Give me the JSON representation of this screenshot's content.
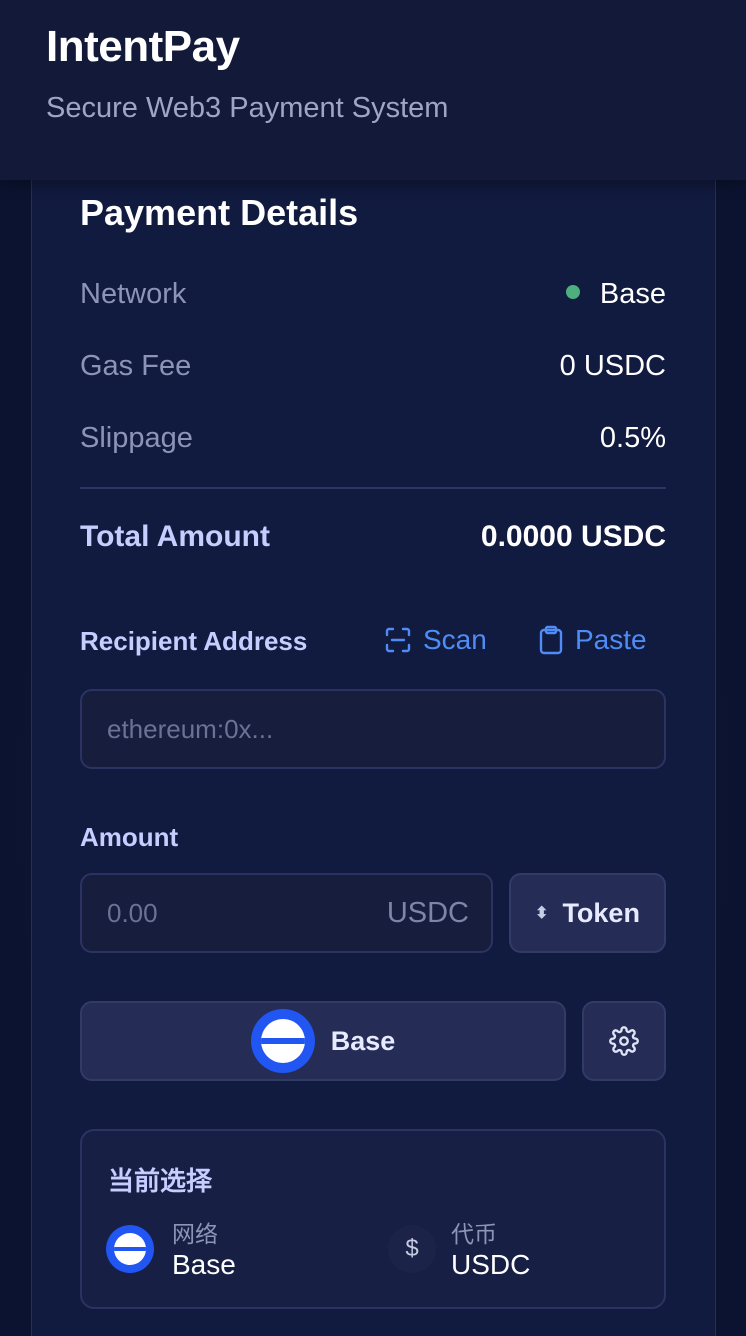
{
  "header": {
    "title": "IntentPay",
    "subtitle": "Secure Web3 Payment System"
  },
  "details": {
    "title": "Payment Details",
    "network_label": "Network",
    "network_value": "Base",
    "gas_label": "Gas Fee",
    "gas_value": "0 USDC",
    "slippage_label": "Slippage",
    "slippage_value": "0.5%",
    "total_label": "Total Amount",
    "total_value": "0.0000 USDC",
    "network_status_color": "#4caf7d"
  },
  "recipient": {
    "label": "Recipient Address",
    "scan_label": "Scan",
    "paste_label": "Paste",
    "placeholder": "ethereum:0x..."
  },
  "amount": {
    "label": "Amount",
    "placeholder": "0.00",
    "unit": "USDC",
    "token_button": "Token"
  },
  "network_selector": {
    "label": "Base",
    "icon": "base-network-icon",
    "settings_icon": "gear-icon"
  },
  "current_selection": {
    "title": "当前选择",
    "network_key": "网络",
    "network_value": "Base",
    "token_key": "代币",
    "token_value": "USDC",
    "token_icon": "$"
  },
  "colors": {
    "accent": "#4f8cf5",
    "base_blue": "#2156f2",
    "background": "#0b1330"
  }
}
